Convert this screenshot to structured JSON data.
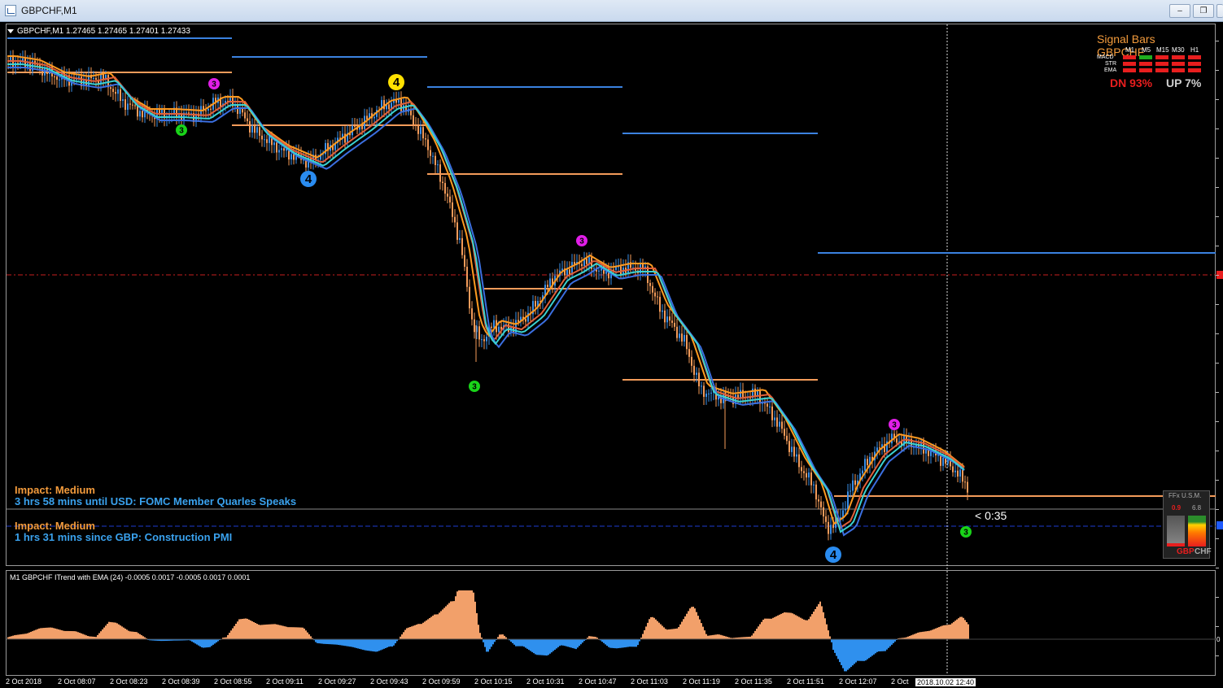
{
  "window": {
    "title": "GBPCHF,M1",
    "minimize_label": "–",
    "restore_label": "❐",
    "close_label": "✕"
  },
  "chart": {
    "symbol_line": "GBPCHF,M1  1.27465 1.27465 1.27401 1.27433",
    "colors": {
      "bull": "#3a8fe8",
      "bear": "#f39b5a",
      "ema_fast": "#ff9a20",
      "ema_slow": "#3b6fe0",
      "magenta": "#e11ee8",
      "green": "#19d419",
      "yellow": "#ffe100",
      "blue_dot": "#2a8cf0"
    }
  },
  "markers": [
    {
      "label": "3",
      "color": "magenta"
    },
    {
      "label": "3",
      "color": "green"
    },
    {
      "label": "4",
      "color": "blue_dot"
    },
    {
      "label": "4",
      "color": "yellow"
    },
    {
      "label": "3",
      "color": "green"
    },
    {
      "label": "3",
      "color": "magenta"
    },
    {
      "label": "3",
      "color": "magenta"
    },
    {
      "label": "4",
      "color": "blue_dot"
    },
    {
      "label": "3",
      "color": "green"
    }
  ],
  "news": [
    {
      "impact": "Impact: Medium",
      "text": "3 hrs 58 mins until USD: FOMC Member Quarles Speaks"
    },
    {
      "impact": "Impact: Medium",
      "text": "1 hrs 31 mins since GBP: Construction PMI"
    }
  ],
  "countdown": "< 0:35",
  "signal_bars": {
    "title": "Signal Bars GBPCHF",
    "timeframes": [
      "M1",
      "M5",
      "M15",
      "M30",
      "H1"
    ],
    "rows": [
      "MACD",
      "STR",
      "EMA"
    ],
    "dn": "DN 93%",
    "up": "UP 7%"
  },
  "usm": {
    "title": "FFx U.S.M.",
    "gbp_value": "0.9",
    "chf_value": "6.8",
    "gbp": "GBP",
    "chf": "CHF"
  },
  "indicator": {
    "title": "M1 GBPCHF ITrend with EMA (24) -0.0005 0.0017 -0.0005 0.0017 0.0001",
    "zero_label": "0"
  },
  "time_axis": {
    "labels": [
      "2 Oct 2018",
      "2 Oct 08:07",
      "2 Oct 08:23",
      "2 Oct 08:39",
      "2 Oct 08:55",
      "2 Oct 09:11",
      "2 Oct 09:27",
      "2 Oct 09:43",
      "2 Oct 09:59",
      "2 Oct 10:15",
      "2 Oct 10:31",
      "2 Oct 10:47",
      "2 Oct 11:03",
      "2 Oct 11:19",
      "2 Oct 11:35",
      "2 Oct 11:51",
      "2 Oct 12:07",
      "2 Oct"
    ],
    "cursor_time": "2018.10.02 12:40"
  }
}
